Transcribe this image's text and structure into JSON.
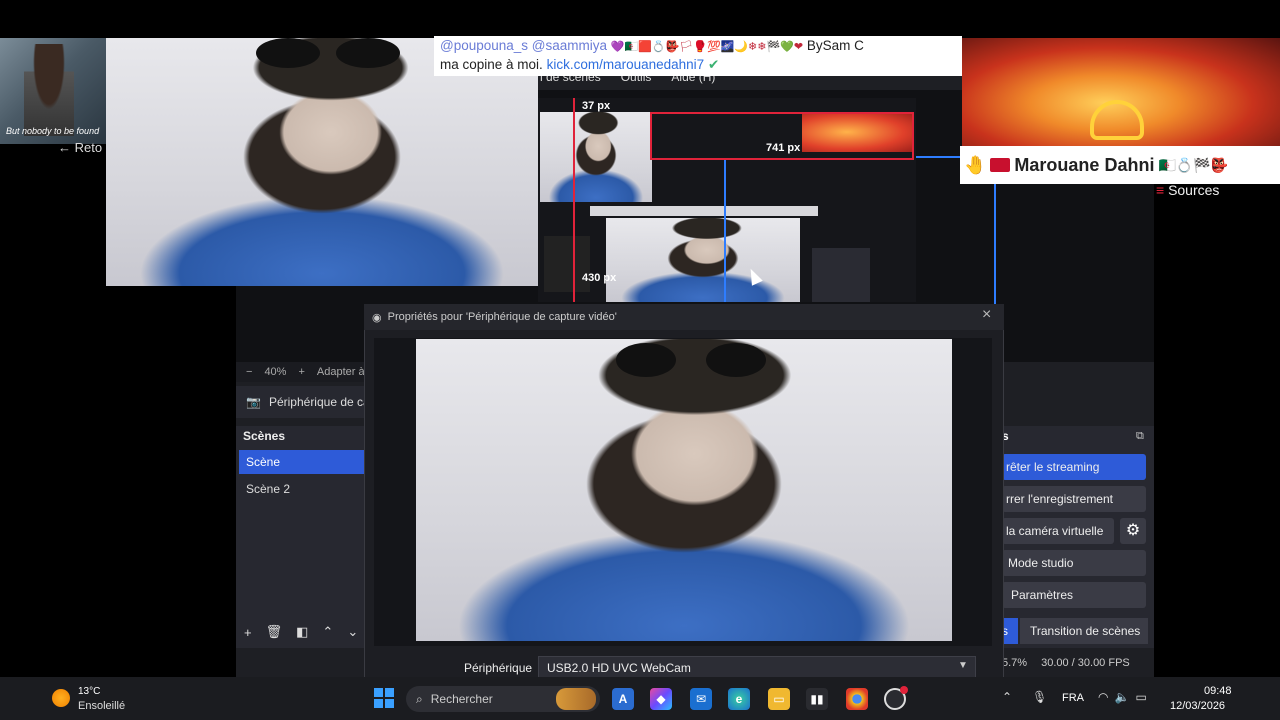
{
  "obs": {
    "menu": [
      "n de scènes",
      "Outils",
      "Aide (H)"
    ],
    "zoom": "40%",
    "zoom_fit": "Adapter à",
    "source_label": "Périphérique de ca",
    "sources_title": "Sources",
    "scenes_title": "Scènes",
    "scenes": [
      "Scène",
      "Scène 2"
    ],
    "controls": {
      "stop_streaming": "rêter le streaming",
      "stop_recording": "rrer l'enregistrement",
      "virtual_camera": "la caméra virtuelle",
      "studio_mode": "Mode studio",
      "settings": "Paramètres",
      "transition": "Transition de scènes",
      "tab_left": "s"
    },
    "status": {
      "cpu": "5.7%",
      "fps": "30.00 / 30.00 FPS"
    }
  },
  "dialog": {
    "title": "Propriétés pour 'Périphérique de capture vidéo'",
    "device_label": "Périphérique",
    "device_value": "USB2.0 HD UVC WebCam"
  },
  "nested": {
    "measure_top": "37 px",
    "measure_bottom": "430 px",
    "measure_right": "741 px"
  },
  "chat": {
    "user1": "@poupouna_s",
    "user2": "@saammiya",
    "emojis": "💜🇩🇿🟥💍👺🏳🥊💯🌌🌙❄❄🏁💚❤",
    "by": "BySam C",
    "line2_text": "ma copine à moi.",
    "link": "kick.com/marouanedahni7",
    "verified": "✔"
  },
  "thumb_left": {
    "caption": "But nobody to be found",
    "back": "Reto"
  },
  "banner": {
    "name": "Marouane Dahni",
    "emojis": "🇩🇿💍🏁👺"
  },
  "taskbar": {
    "weather_temp": "13°C",
    "weather_desc": "Ensoleillé",
    "search_placeholder": "Rechercher",
    "language": "FRA",
    "time": "09:48",
    "date": "12/03/2026"
  }
}
